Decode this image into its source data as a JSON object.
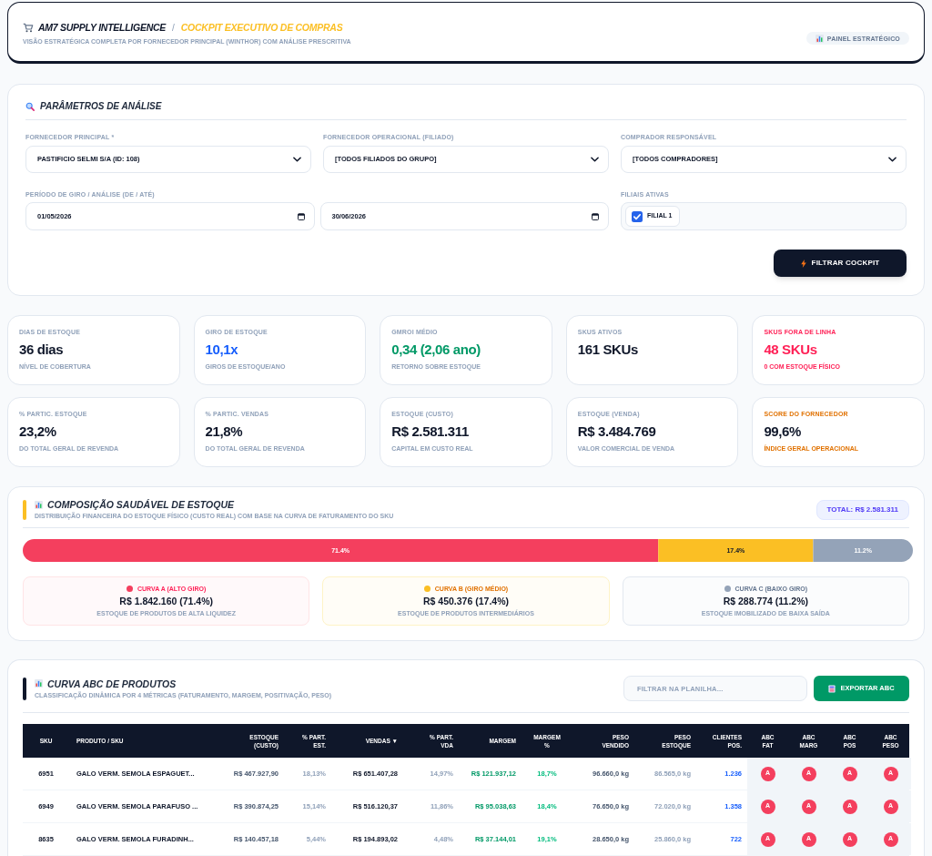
{
  "header": {
    "brand": "AM7 SUPPLY INTELLIGENCE",
    "separator": "/",
    "title": "COCKPIT EXECUTIVO DE COMPRAS",
    "subtitle": "VISÃO ESTRATÉGICA COMPLETA POR FORNECEDOR PRINCIPAL (WINTHOR) COM ANÁLISE PRESCRITIVA",
    "badge": "PAINEL ESTRATÉGICO"
  },
  "parameters": {
    "title": "PARÂMETROS DE ANÁLISE",
    "selects": [
      {
        "label": "FORNECEDOR PRINCIPAL *",
        "value": "PASTIFICIO SELMI S/A (ID: 108)"
      },
      {
        "label": "FORNECEDOR OPERACIONAL (FILIADO)",
        "value": "[TODOS FILIADOS DO GRUPO]"
      },
      {
        "label": "COMPRADOR RESPONSÁVEL",
        "value": "[TODOS COMPRADORES]"
      }
    ],
    "period": {
      "label": "PERÍODO DE GIRO / ANÁLISE (DE / ATÉ)",
      "from": "01/05/2026",
      "to": "30/06/2026"
    },
    "branches": {
      "label": "FILIAIS ATIVAS",
      "items": [
        {
          "label": "FILIAL 1",
          "checked": true
        }
      ]
    },
    "button": "FILTRAR COCKPIT"
  },
  "kpis": [
    {
      "label": "DIAS DE ESTOQUE",
      "value": "36 dias",
      "note": "NÍVEL DE COBERTURA",
      "kind": "neutral"
    },
    {
      "label": "GIRO DE ESTOQUE",
      "value": "10,1x",
      "note": "GIROS DE ESTOQUE/ANO",
      "kind": "info"
    },
    {
      "label": "GMROI MÉDIO",
      "value": "0,34 (2,06 ano)",
      "note": "RETORNO SOBRE ESTOQUE",
      "kind": "positive"
    },
    {
      "label": "SKUS ATIVOS",
      "value": "161 SKUs",
      "kind": "neutral"
    },
    {
      "label": "SKUS FORA DE LINHA",
      "value": "48 SKUs",
      "note": "0 COM ESTOQUE FÍSICO",
      "kind": "alert"
    },
    {
      "label": "% PARTIC. ESTOQUE",
      "value": "23,2%",
      "note": "DO TOTAL GERAL DE REVENDA",
      "kind": "neutral"
    },
    {
      "label": "% PARTIC. VENDAS",
      "value": "21,8%",
      "note": "DO TOTAL GERAL DE REVENDA",
      "kind": "neutral"
    },
    {
      "label": "ESTOQUE (CUSTO)",
      "value": "R$ 2.581.311",
      "note": "CAPITAL EM CUSTO REAL",
      "kind": "neutral"
    },
    {
      "label": "ESTOQUE (VENDA)",
      "value": "R$ 3.484.769",
      "note": "VALOR COMERCIAL DE VENDA",
      "kind": "neutral"
    },
    {
      "label": "SCORE DO FORNECEDOR",
      "value": "99,6%",
      "note": "ÍNDICE GERAL OPERACIONAL",
      "kind": "score"
    }
  ],
  "composition": {
    "title": "COMPOSIÇÃO SAUDÁVEL DE ESTOQUE",
    "subtitle": "DISTRIBUIÇÃO FINANCEIRA DO ESTOQUE FÍSICO (CUSTO REAL) COM BASE NA CURVA DE FATURAMENTO DO SKU",
    "total": "TOTAL: R$ 2.581.311",
    "chart_data": {
      "type": "bar",
      "orientation": "horizontal",
      "stacked": true,
      "series": [
        {
          "color": "#f43f5e",
          "values": [
            71.4
          ],
          "value_labels": [
            "71.4%"
          ]
        },
        {
          "color": "#fbbf24",
          "values": [
            17.4
          ],
          "value_labels": [
            "17.4%"
          ]
        },
        {
          "color": "#94a3b8",
          "values": [
            11.2
          ],
          "value_labels": [
            "11.2%"
          ]
        }
      ]
    },
    "cards": [
      {
        "title": "CURVA A (ALTO GIRO)",
        "value": "R$ 1.842.160 (71.4%)",
        "note": "ESTOQUE DE PRODUTOS DE ALTA LIQUIDEZ",
        "color": "#f43f5e",
        "kind": "a"
      },
      {
        "title": "CURVA B (GIRO MÉDIO)",
        "value": "R$ 450.376 (17.4%)",
        "note": "ESTOQUE DE PRODUTOS INTERMEDIÁRIOS",
        "color": "#fbbf24",
        "kind": "b"
      },
      {
        "title": "CURVA C (BAIXO GIRO)",
        "value": "R$ 288.774 (11.2%)",
        "note": "ESTOQUE IMOBILIZADO DE BAIXA SAÍDA",
        "color": "#94a3b8",
        "kind": "c"
      }
    ]
  },
  "abc": {
    "title": "CURVA ABC DE PRODUTOS",
    "subtitle": "CLASSIFICAÇÃO DINÂMICA POR 4 MÉTRICAS (FATURAMENTO, MARGEM, POSITIVAÇÃO, PESO)",
    "filter": {
      "placeholder": "FILTRAR NA PLANILHA..."
    },
    "export_button": "EXPORTAR ABC",
    "columns": [
      "SKU",
      "PRODUTO / SKU",
      "ESTOQUE (CUSTO)",
      "% PART. EST.",
      "VENDAS ▼",
      "% PART. VDA",
      "MARGEM",
      "MARGEM %",
      "PESO VENDIDO",
      "PESO ESTOQUE",
      "CLIENTES POS.",
      "ABC FAT",
      "ABC MARG",
      "ABC POS",
      "ABC PESO"
    ],
    "rows": [
      {
        "cells": [
          "6951",
          "GALO VERM. SEMOLA ESPAGUET...",
          "R$ 467.927,90",
          "18,13%",
          "R$ 651.407,28",
          "14,97%",
          "R$ 121.937,12",
          "18,7%",
          "96.660,0 kg",
          "86.565,0 kg",
          "1.236"
        ],
        "abc": [
          {
            "label": "A",
            "color": "#f43f5e"
          },
          {
            "label": "A",
            "color": "#f43f5e"
          },
          {
            "label": "A",
            "color": "#f43f5e"
          },
          {
            "label": "A",
            "color": "#f43f5e"
          }
        ]
      },
      {
        "cells": [
          "6949",
          "GALO VERM. SEMOLA PARAFUSO ...",
          "R$ 390.874,25",
          "15,14%",
          "R$ 516.120,37",
          "11,86%",
          "R$ 95.038,63",
          "18,4%",
          "76.650,0 kg",
          "72.020,0 kg",
          "1.358"
        ],
        "abc": [
          {
            "label": "A",
            "color": "#f43f5e"
          },
          {
            "label": "A",
            "color": "#f43f5e"
          },
          {
            "label": "A",
            "color": "#f43f5e"
          },
          {
            "label": "A",
            "color": "#f43f5e"
          }
        ]
      },
      {
        "cells": [
          "8635",
          "GALO VERM. SEMOLA FURADINH...",
          "R$ 140.457,18",
          "5,44%",
          "R$ 194.893,02",
          "4,48%",
          "R$ 37.144,01",
          "19,1%",
          "28.650,0 kg",
          "25.860,0 kg",
          "722"
        ],
        "abc": [
          {
            "label": "A",
            "color": "#f43f5e"
          },
          {
            "label": "A",
            "color": "#f43f5e"
          },
          {
            "label": "A",
            "color": "#f43f5e"
          },
          {
            "label": "A",
            "color": "#f43f5e"
          }
        ]
      }
    ]
  }
}
